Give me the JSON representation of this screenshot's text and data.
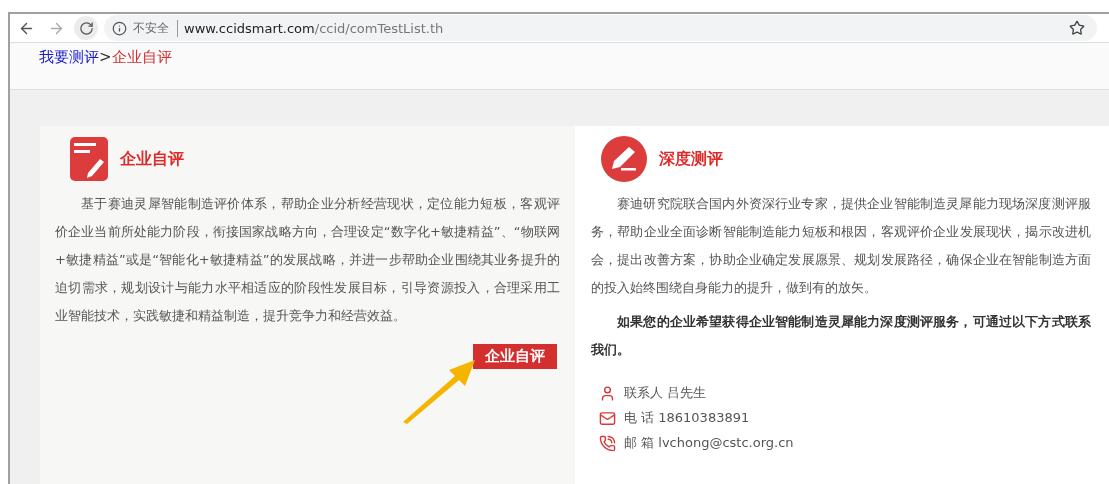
{
  "browser": {
    "security_label": "不安全",
    "url_host": "www.ccidsmart.com",
    "url_path": "/ccid/comTestList.th"
  },
  "breadcrumb": {
    "items": [
      {
        "label": "我要测评",
        "kind": "link"
      },
      {
        "label": ">",
        "kind": "separator"
      },
      {
        "label": "企业自评",
        "kind": "current"
      }
    ]
  },
  "self_assessment": {
    "title": "企业自评",
    "body": "基于赛迪灵犀智能制造评价体系，帮助企业分析经营现状，定位能力短板，客观评价企业当前所处能力阶段，衔接国家战略方向，合理设定“数字化+敏捷精益”、“物联网+敏捷精益”或是“智能化+敏捷精益”的发展战略，并进一步帮助企业围绕其业务提升的迫切需求，规划设计与能力水平相适应的阶段性发展目标，引导资源投入，合理采用工业智能技术，实践敏捷和精益制造，提升竞争力和经营效益。",
    "button": "企业自评"
  },
  "deep_assessment": {
    "title": "深度测评",
    "body": "赛迪研究院联合国内外资深行业专家，提供企业智能制造灵犀能力现场深度测评服务，帮助企业全面诊断智能制造能力短板和根因，客观评价企业发展现状，揭示改进机会，提出改善方案，协助企业确定发展愿景、规划发展路径，确保企业在智能制造方面的投入始终围绕自身能力的提升，做到有的放矢。",
    "note": "如果您的企业希望获得企业智能制造灵犀能力深度测评服务，可通过以下方式联系我们。",
    "contacts": [
      {
        "kind": "person",
        "text": "联系人 吕先生"
      },
      {
        "kind": "mail",
        "text": "电 话 18610383891"
      },
      {
        "kind": "phone",
        "text": "邮 箱 lvchong@cstc.org.cn"
      }
    ]
  }
}
